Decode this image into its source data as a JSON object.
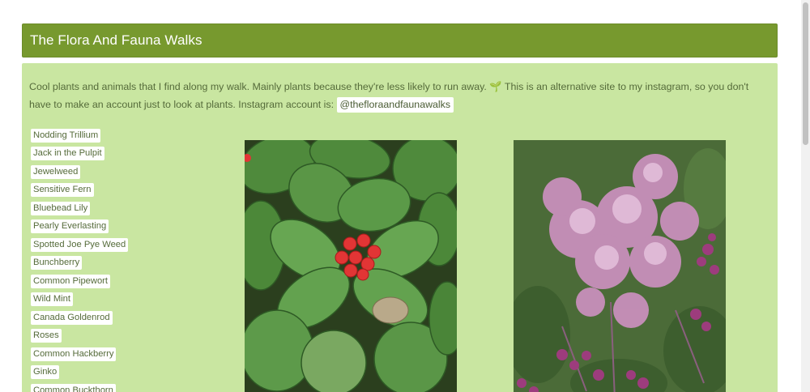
{
  "site": {
    "title": "The Flora And Fauna Walks"
  },
  "intro": {
    "text": "Cool plants and animals that I find along my walk. Mainly plants because they're less likely to run away. 🌱 This is an alternative site to my instagram, so you don't have to make an account just to look at plants. Instagram account is: ",
    "instagram_handle": "@thefloraandfaunawalks"
  },
  "plants": [
    "Nodding Trillium",
    "Jack in the Pulpit",
    "Jewelweed",
    "Sensitive Fern",
    "Bluebead Lily",
    "Pearly Everlasting",
    "Spotted Joe Pye Weed",
    "Bunchberry",
    "Common Pipewort",
    "Wild Mint",
    "Canada Goldenrod",
    "Roses",
    "Common Hackberry",
    "Ginko",
    "Common Buckthorn"
  ],
  "colors": {
    "header_bg": "#77992e",
    "content_bg": "#c9e6a1",
    "text": "#556b3a"
  }
}
